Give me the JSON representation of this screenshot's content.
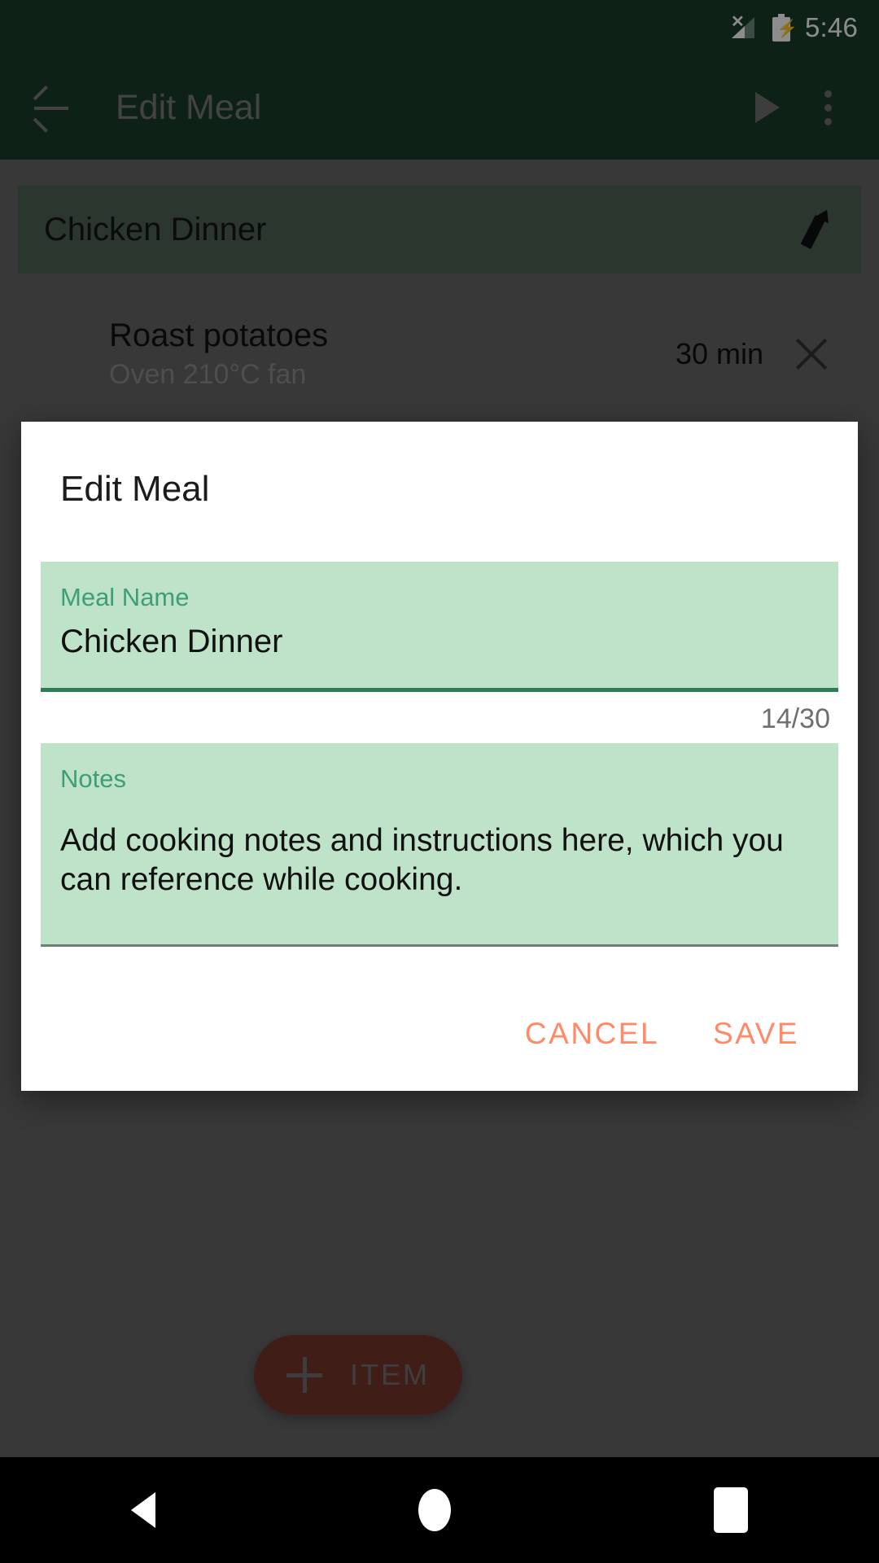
{
  "status_bar": {
    "time": "5:46",
    "signal_icon": "signal-no-service-icon",
    "battery_icon": "battery-charging-icon"
  },
  "app_bar": {
    "back_icon": "back-arrow-icon",
    "title": "Edit Meal",
    "play_icon": "play-icon",
    "overflow_icon": "overflow-menu-icon",
    "background_color": "#1b3d2b",
    "title_color": "#7b7b7b"
  },
  "meal_card": {
    "title": "Chicken Dinner",
    "edit_icon": "pencil-icon",
    "background_color": "#4e6355"
  },
  "item_list": [
    {
      "title": "Roast potatoes",
      "subtitle": "Oven 210°C fan",
      "duration": "30 min",
      "remove_icon": "close-icon"
    }
  ],
  "fab": {
    "plus_icon": "plus-icon",
    "label": "ITEM",
    "background_color": "#76382a"
  },
  "dialog": {
    "title": "Edit Meal",
    "meal_name_field": {
      "label": "Meal Name",
      "value": "Chicken Dinner",
      "placeholder": "Meal Name",
      "counter": "14/30",
      "fill_color": "#bee3c8",
      "label_color": "#3f9e79",
      "underline_color": "#2e7d59"
    },
    "notes_field": {
      "label": "Notes",
      "value": "Add cooking notes and instructions here, which you can reference while cooking.",
      "placeholder": "Notes",
      "fill_color": "#bee3c8",
      "label_color": "#3f9e79"
    },
    "cancel_label": "CANCEL",
    "save_label": "SAVE",
    "action_color": "#ff8a65"
  },
  "nav_bar": {
    "back_icon": "nav-back-icon",
    "home_icon": "nav-home-icon",
    "recents_icon": "nav-recents-icon"
  }
}
